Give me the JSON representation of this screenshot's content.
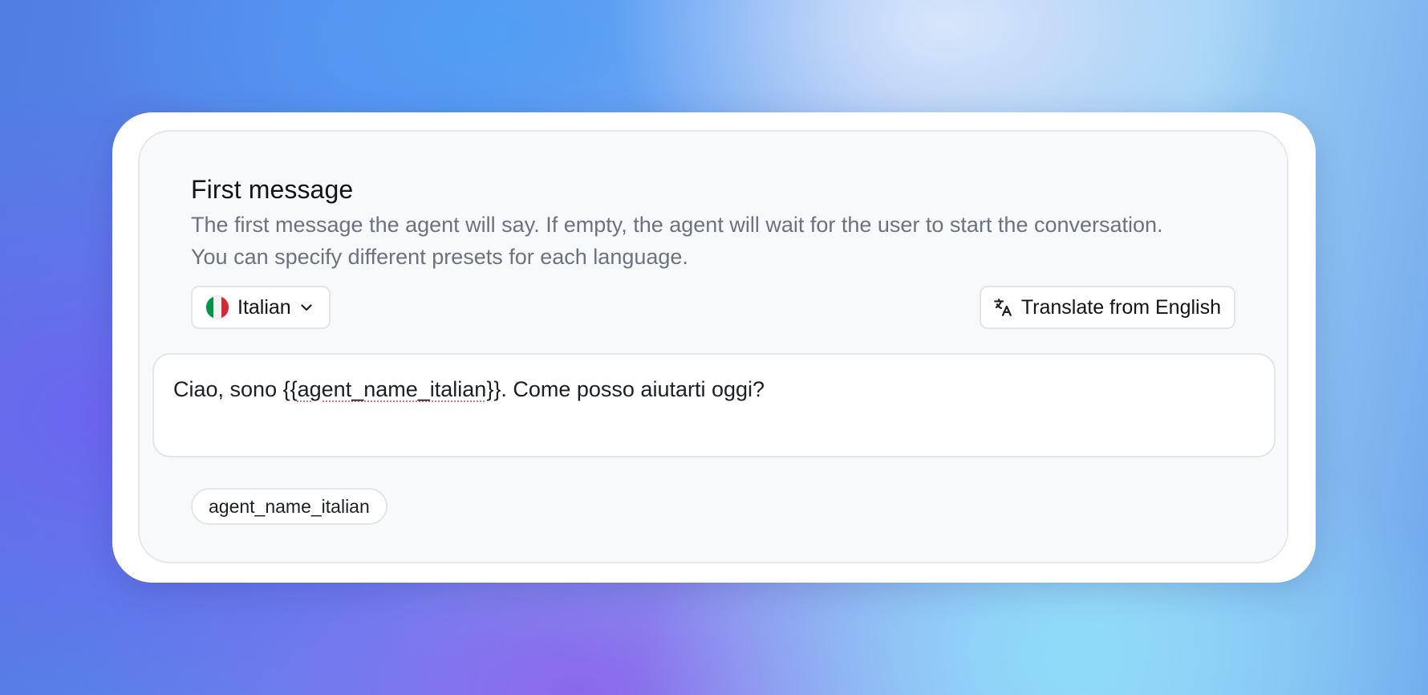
{
  "section": {
    "title": "First message",
    "description": "The first message the agent will say. If empty, the agent will wait for the user to start the conversation. You can specify different presets for each language."
  },
  "language_select": {
    "selected": "Italian",
    "flag_icon": "italy-flag-icon",
    "flag_colors": [
      "#009246",
      "#f1f2f1",
      "#ce2b37"
    ],
    "chevron_icon": "chevron-down-icon"
  },
  "translate_button": {
    "icon": "translate-icon",
    "label": "Translate from English"
  },
  "message": {
    "prefix": "Ciao, sono {{",
    "variable": "agent_name_italian",
    "suffix": "}}. Come posso aiutarti oggi?"
  },
  "variables": [
    "agent_name_italian"
  ]
}
